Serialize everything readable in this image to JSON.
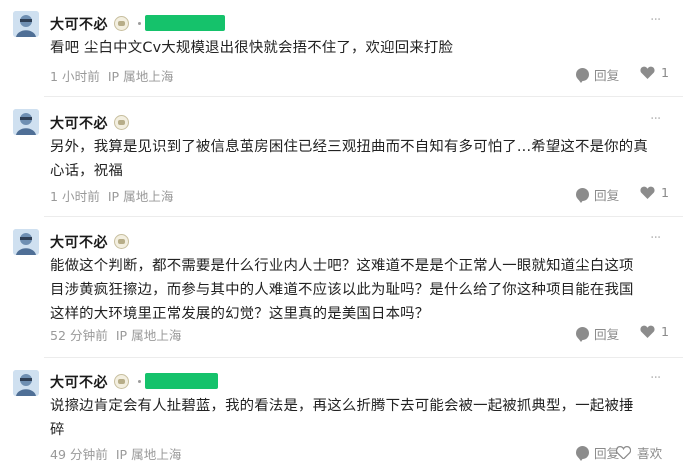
{
  "comments": [
    {
      "name": "大可不必",
      "has_tag": true,
      "text_lines": [
        "看吧 尘白中文Cv大规模退出很快就会捂不住了，欢迎回来打脸"
      ],
      "time": "1 小时前",
      "location": "IP 属地上海",
      "reply_label": "回复",
      "like_label": "1"
    },
    {
      "name": "大可不必",
      "has_tag": false,
      "text_lines": [
        "另外，我算是见识到了被信息茧房困住已经三观扭曲而不自知有多可怕了...希望这不是你的真",
        "心话，祝福"
      ],
      "time": "1 小时前",
      "location": "IP 属地上海",
      "reply_label": "回复",
      "like_label": "1"
    },
    {
      "name": "大可不必",
      "has_tag": false,
      "text_lines": [
        "能做这个判断，都不需要是什么行业内人士吧？这难道不是是个正常人一眼就知道尘白这项",
        "目涉黄疯狂擦边，而参与其中的人难道不应该以此为耻吗？是什么给了你这种项目能在我国",
        "这样的大环境里正常发展的幻觉？这里真的是美国日本吗？"
      ],
      "time": "52 分钟前",
      "location": "IP 属地上海",
      "reply_label": "回复",
      "like_label": "1"
    },
    {
      "name": "大可不必",
      "has_tag": true,
      "text_lines": [
        "说擦边肯定会有人扯碧蓝，我的看法是，再这么折腾下去可能会被一起被抓典型，一起被捶",
        "碎"
      ],
      "time": "49 分钟前",
      "location": "IP 属地上海",
      "reply_label": "回复",
      "like_label": "喜欢"
    }
  ],
  "colors": {
    "tag_green": "#15c26b",
    "meta_gray": "#9a9a9a",
    "avatar_bg": "#c9ddef"
  },
  "icons": [
    "avatar-icon",
    "level-badge-icon",
    "more-icon",
    "reply-icon",
    "heart-icon"
  ]
}
